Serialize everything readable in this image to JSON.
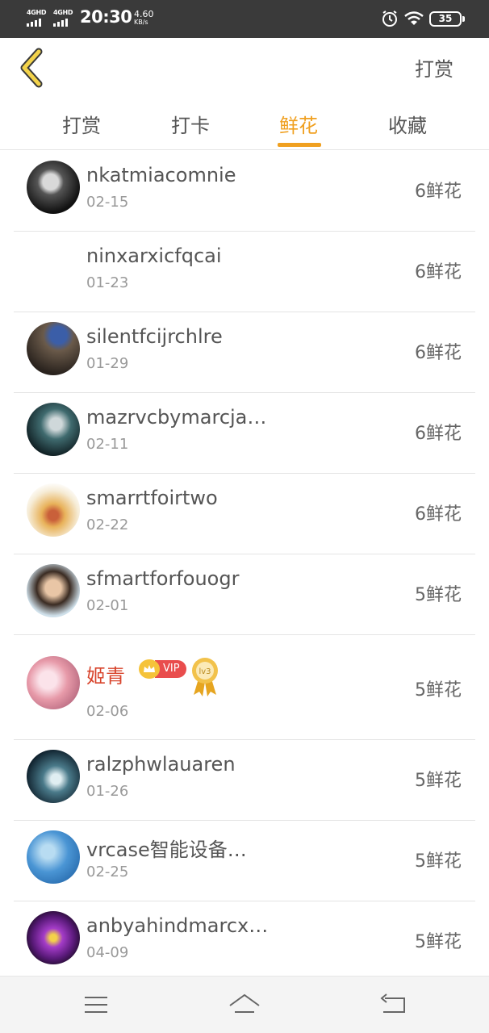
{
  "status_bar": {
    "signal1_label": "4GHD",
    "signal2_label": "4GHD",
    "time": "20:30",
    "net_speed": "4.60",
    "net_speed_unit": "KB/s",
    "battery": "35",
    "icons": [
      "alarm-icon",
      "wifi-icon",
      "battery-icon"
    ]
  },
  "header": {
    "back_icon": "chevron-left-icon",
    "title": "打赏"
  },
  "tabs": [
    {
      "label": "打赏",
      "active": false
    },
    {
      "label": "打卡",
      "active": false
    },
    {
      "label": "鲜花",
      "active": true
    },
    {
      "label": "收藏",
      "active": false
    }
  ],
  "accent_color": "#f0a020",
  "list": [
    {
      "name": "nkatmiacomnie",
      "date": "02-15",
      "count": "6鲜花"
    },
    {
      "name": "ninxarxicfqcai",
      "date": "01-23",
      "count": "6鲜花"
    },
    {
      "name": "silentfcijrchlre",
      "date": "01-29",
      "count": "6鲜花"
    },
    {
      "name": "mazrvcbymarcja…",
      "date": "02-11",
      "count": "6鲜花"
    },
    {
      "name": "smarrtfoirtwo",
      "date": "02-22",
      "count": "6鲜花"
    },
    {
      "name": "sfmartforfouogr",
      "date": "02-01",
      "count": "5鲜花"
    },
    {
      "name": "姬青",
      "date": "02-06",
      "count": "5鲜花",
      "vip_label": "VIP",
      "level_label": "lv3"
    },
    {
      "name": "ralzphwlauaren",
      "date": "01-26",
      "count": "5鲜花"
    },
    {
      "name": "vrcase智能设备…",
      "date": "02-25",
      "count": "5鲜花"
    },
    {
      "name": "anbyahindmarcx…",
      "date": "04-09",
      "count": "5鲜花"
    }
  ],
  "nav_bar": {
    "icons": [
      "menu-icon",
      "home-icon",
      "back-icon"
    ]
  }
}
